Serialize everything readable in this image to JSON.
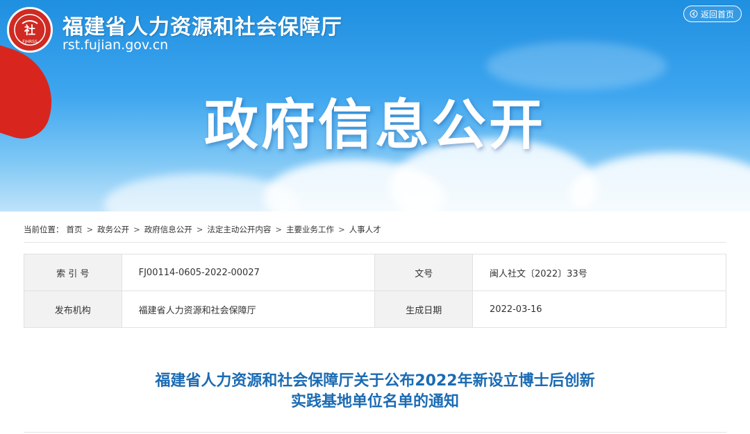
{
  "header": {
    "site_name": "福建省人力资源和社会保障厅",
    "site_url": "rst.fujian.gov.cn",
    "emblem_char": "社",
    "emblem_letters": "FJHRSS",
    "home_button_label": "返回首页",
    "hero_title": "政府信息公开"
  },
  "breadcrumb": {
    "prefix": "当前位置：",
    "items": [
      "首页",
      "政务公开",
      "政府信息公开",
      "法定主动公开内容",
      "主要业务工作",
      "人事人才"
    ],
    "separator": ">"
  },
  "meta": {
    "index_label": "索 引 号",
    "index_value": "FJ00114-0605-2022-00027",
    "doc_no_label": "文号",
    "doc_no_value": "闽人社文〔2022〕33号",
    "publisher_label": "发布机构",
    "publisher_value": "福建省人力资源和社会保障厅",
    "date_label": "生成日期",
    "date_value": "2022-03-16"
  },
  "article": {
    "title_line1": "福建省人力资源和社会保障厅关于公布2022年新设立博士后创新",
    "title_line2": "实践基地单位名单的通知"
  },
  "colors": {
    "banner_blue": "#2e9be8",
    "emblem_red": "#d02a22",
    "title_blue": "#1b6bb3"
  }
}
